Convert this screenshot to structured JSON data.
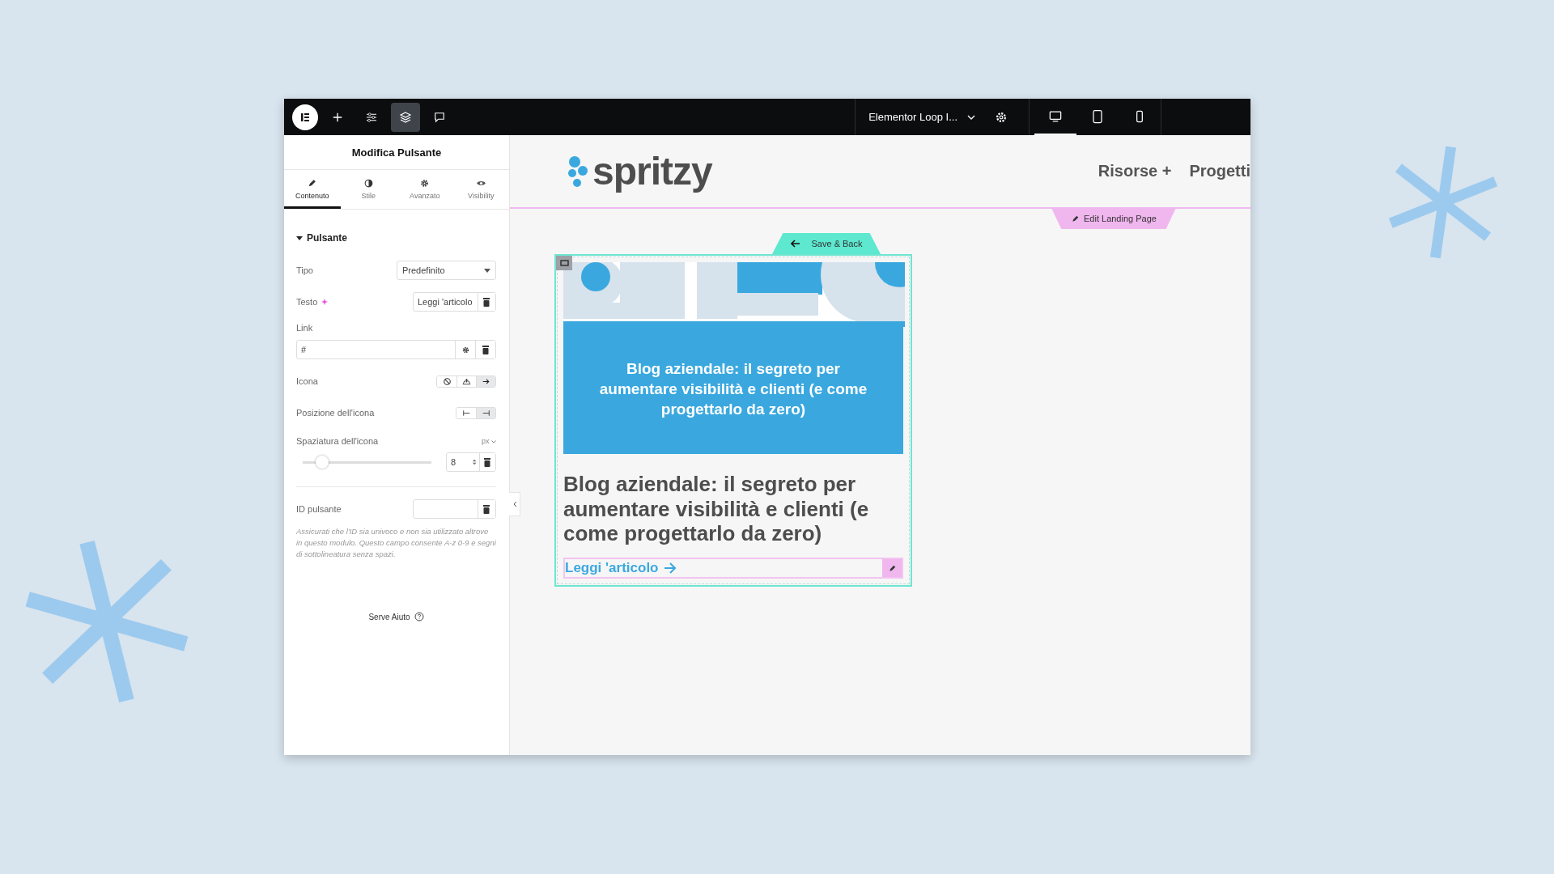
{
  "topbar": {
    "tools": [
      {
        "kind": "add",
        "selected": false
      },
      {
        "kind": "sliders",
        "selected": false
      },
      {
        "kind": "layers",
        "selected": true
      },
      {
        "kind": "comment",
        "selected": false
      }
    ],
    "document_title": "Elementor Loop I...",
    "devices": [
      {
        "kind": "desktop",
        "selected": true
      },
      {
        "kind": "tablet",
        "selected": false
      },
      {
        "kind": "mobile",
        "selected": false
      }
    ]
  },
  "panel": {
    "title": "Modifica Pulsante",
    "tabs": [
      {
        "label": "Contenuto",
        "kind": "pencil",
        "selected": true
      },
      {
        "label": "Stile",
        "kind": "contrast",
        "selected": false
      },
      {
        "label": "Avanzato",
        "kind": "gear",
        "selected": false
      },
      {
        "label": "Visibility",
        "kind": "eye",
        "selected": false
      }
    ],
    "section": {
      "title": "Pulsante",
      "expanded": true
    },
    "tipo": {
      "label": "Tipo",
      "value": "Predefinito"
    },
    "testo": {
      "label": "Testo",
      "value": "Leggi 'articolo"
    },
    "link": {
      "label": "Link",
      "value": "#"
    },
    "icona": {
      "label": "Icona",
      "options": [
        {
          "kind": "none",
          "selected": false
        },
        {
          "kind": "upload",
          "selected": false
        },
        {
          "kind": "arrow",
          "selected": true
        }
      ]
    },
    "posizione": {
      "label": "Posizione dell'icona",
      "options": [
        {
          "kind": "before",
          "selected": false
        },
        {
          "kind": "after",
          "selected": true
        }
      ]
    },
    "spaziatura": {
      "label": "Spaziatura dell'icona",
      "unit": "px",
      "level": 0.15,
      "value": "8"
    },
    "id": {
      "label": "ID pulsante",
      "help": "Assicurati che l'ID sia univoco e non sia utilizzato altrove in questo modulo. Questo campo consente A-z 0-9 e segni di sottolineatura senza spazi."
    },
    "help_link": "Serve Aiuto"
  },
  "canvas": {
    "logo": "spritzy",
    "nav": [
      "Risorse +",
      "Progetti"
    ],
    "edit_tab": "Edit Landing Page",
    "save_tab": "Save & Back",
    "card": {
      "image_caption": "Blog aziendale: il segreto per aumentare visibilità e clienti (e come progettarlo da zero)",
      "title": "Blog aziendale: il segreto per aumentare visibilità e clienti (e come progettarlo da zero)",
      "button": "Leggi 'articolo"
    }
  }
}
